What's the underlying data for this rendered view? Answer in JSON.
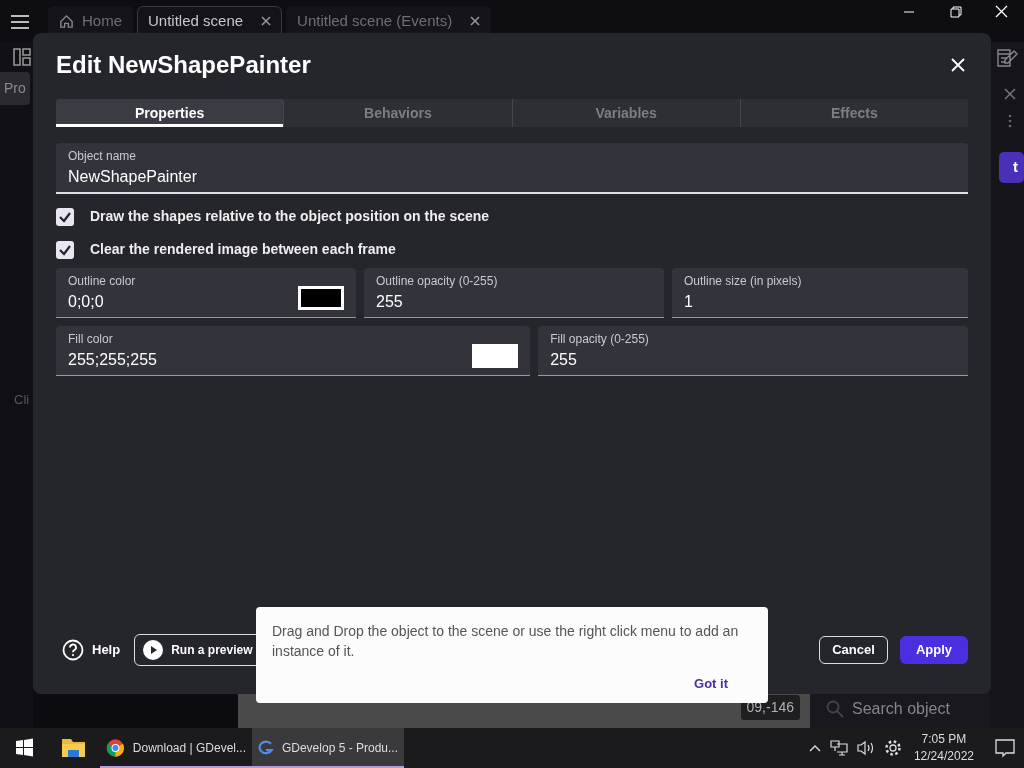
{
  "app_tabs": [
    {
      "label": "Home",
      "kind": "home",
      "selected": false
    },
    {
      "label": "Untitled scene",
      "kind": "closable",
      "selected": true
    },
    {
      "label": "Untitled scene (Events)",
      "kind": "closable",
      "selected": false
    }
  ],
  "sidebar": {
    "tab": "Pro",
    "hint": "Cli"
  },
  "right_panel": {
    "button": "t",
    "search_placeholder": "Search object"
  },
  "canvas": {
    "coordinates": "09,-146"
  },
  "dialog": {
    "title": "Edit NewShapePainter",
    "tabs": [
      {
        "label": "Properties",
        "selected": true
      },
      {
        "label": "Behaviors",
        "selected": false
      },
      {
        "label": "Variables",
        "selected": false
      },
      {
        "label": "Effects",
        "selected": false
      }
    ],
    "object_name": {
      "label": "Object name",
      "value": "NewShapePainter"
    },
    "checkboxes": [
      {
        "label": "Draw the shapes relative to the object position on the scene",
        "checked": true
      },
      {
        "label": "Clear the rendered image between each frame",
        "checked": true
      }
    ],
    "field_rows": [
      [
        {
          "label": "Outline color",
          "value": "0;0;0",
          "kind": "color"
        },
        {
          "label": "Outline opacity (0-255)",
          "value": "255"
        },
        {
          "label": "Outline size (in pixels)",
          "value": "1"
        }
      ],
      [
        {
          "label": "Fill color",
          "value": "255;255;255",
          "kind": "color"
        },
        {
          "label": "Fill opacity (0-255)",
          "value": "255"
        }
      ]
    ],
    "help": "Help",
    "preview": "Run a preview",
    "cancel": "Cancel",
    "apply": "Apply"
  },
  "tooltip": {
    "text": "Drag and Drop the object to the scene or use the right click menu to add an instance of it.",
    "action": "Got it"
  },
  "taskbar": {
    "apps": [
      {
        "label": "Download | GDevel...",
        "kind": "browser",
        "selected": false
      },
      {
        "label": "GDevelop 5 - Produ...",
        "kind": "gdevelop",
        "selected": true
      }
    ],
    "time": "7:05 PM",
    "date": "12/24/2022"
  }
}
